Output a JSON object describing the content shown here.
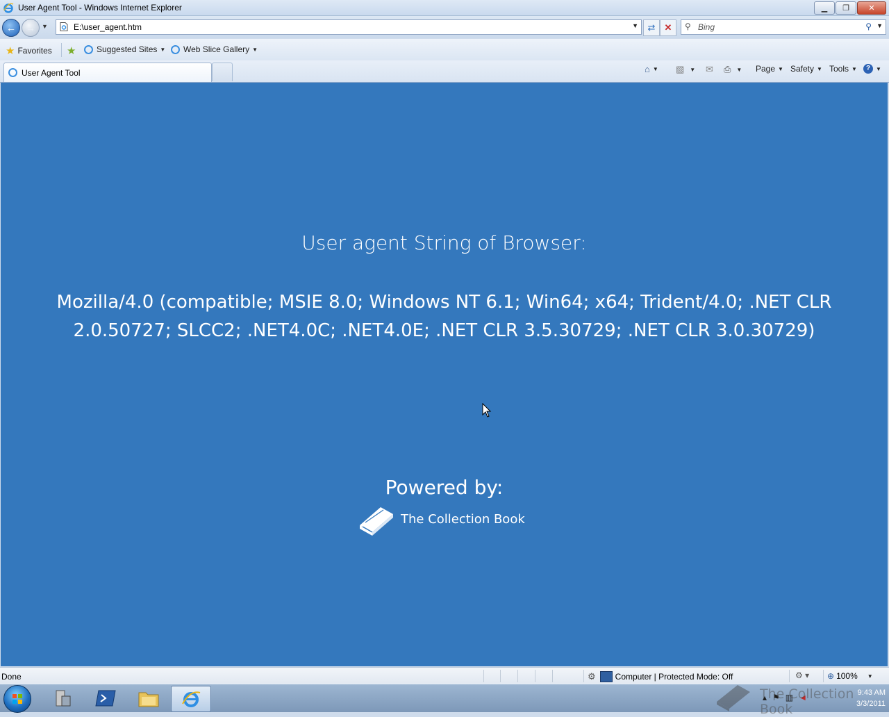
{
  "window": {
    "title": "User Agent Tool - Windows Internet Explorer",
    "controls": [
      "minimize",
      "restore",
      "close"
    ]
  },
  "address_bar": {
    "url": "E:\\user_agent.htm",
    "search_placeholder": "Bing"
  },
  "favorites_bar": {
    "favorites_label": "Favorites",
    "items": [
      {
        "label": "Suggested Sites",
        "icon": "ie-page-icon"
      },
      {
        "label": "Web Slice Gallery",
        "icon": "ie-page-icon"
      }
    ]
  },
  "tabs": [
    {
      "label": "User Agent Tool",
      "active": true
    }
  ],
  "command_bar": {
    "page_label": "Page",
    "safety_label": "Safety",
    "tools_label": "Tools"
  },
  "content": {
    "background_color": "#3478bd",
    "heading": "User agent String of Browser:",
    "user_agent": "Mozilla/4.0 (compatible; MSIE 8.0; Windows NT 6.1; Win64; x64; Trident/4.0; .NET CLR 2.0.50727; SLCC2; .NET4.0C; .NET4.0E; .NET CLR 3.5.30729; .NET CLR 3.0.30729)",
    "powered_by": "Powered by:",
    "brand": "The Collection Book"
  },
  "status_bar": {
    "status": "Done",
    "zone": "Computer | Protected Mode: Off",
    "zoom": "100%"
  },
  "taskbar": {
    "clock_time": "9:43 AM",
    "clock_date": "3/3/2011"
  },
  "watermark": {
    "text": "The Collection Book"
  }
}
